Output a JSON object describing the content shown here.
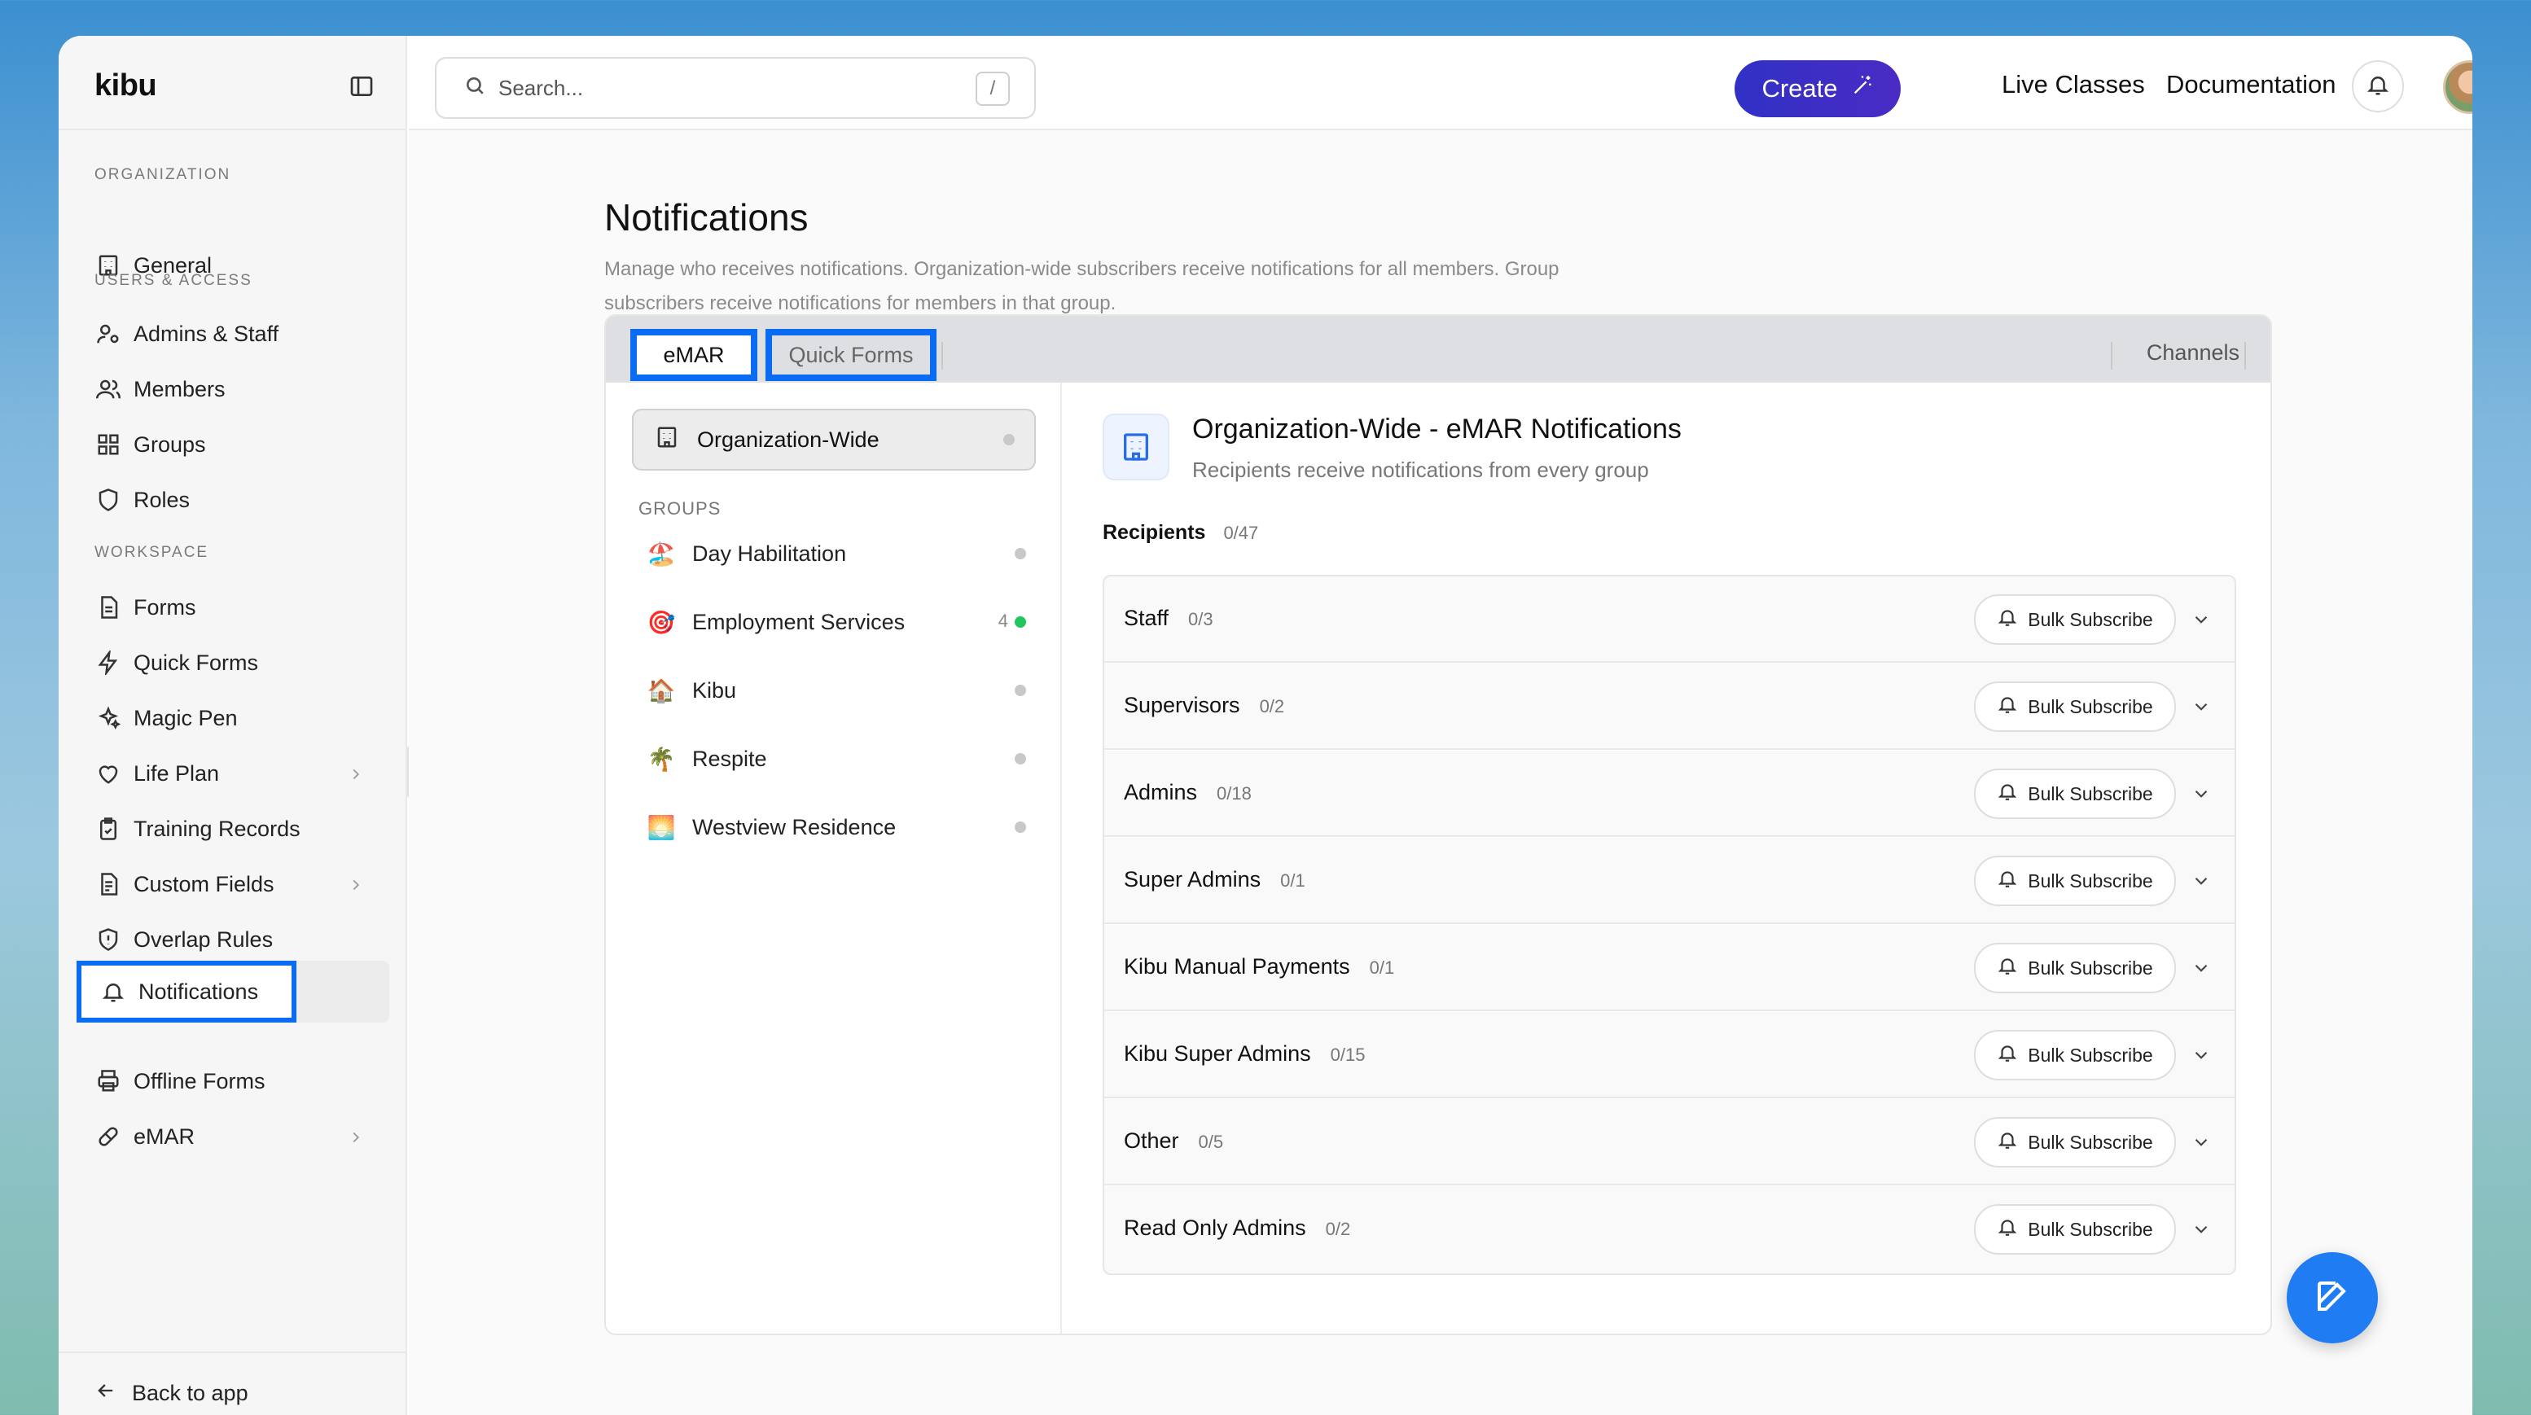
{
  "sidebar": {
    "brand": "kibu",
    "sections": {
      "organization": "ORGANIZATION",
      "users_access": "USERS & ACCESS",
      "workspace": "WORKSPACE"
    },
    "items": {
      "general": "General",
      "admins_staff": "Admins & Staff",
      "members": "Members",
      "groups": "Groups",
      "roles": "Roles",
      "forms": "Forms",
      "quick_forms": "Quick Forms",
      "magic_pen": "Magic Pen",
      "life_plan": "Life Plan",
      "training_records": "Training Records",
      "custom_fields": "Custom Fields",
      "overlap_rules": "Overlap Rules",
      "notifications": "Notifications",
      "offline_forms": "Offline Forms",
      "emar": "eMAR"
    },
    "back": "Back to app"
  },
  "topbar": {
    "search_placeholder": "Search...",
    "search_shortcut": "/",
    "create": "Create",
    "live_classes": "Live Classes",
    "documentation": "Documentation"
  },
  "page": {
    "title": "Notifications",
    "description": "Manage who receives notifications. Organization-wide subscribers receive notifications for all members. Group subscribers receive notifications for members in that group."
  },
  "tabs": {
    "emar": "eMAR",
    "quick_forms": "Quick Forms",
    "channels": "Channels"
  },
  "left_pane": {
    "org_wide": "Organization-Wide",
    "groups_label": "GROUPS",
    "groups": [
      {
        "name": "Day Habilitation",
        "emoji": "🏖️",
        "count": "",
        "status_color": "#c8c8c8"
      },
      {
        "name": "Employment Services",
        "emoji": "🎯",
        "count": "4",
        "status_color": "#22c55e"
      },
      {
        "name": "Kibu",
        "emoji": "🏠",
        "count": "",
        "status_color": "#c8c8c8"
      },
      {
        "name": "Respite",
        "emoji": "🌴",
        "count": "",
        "status_color": "#c8c8c8"
      },
      {
        "name": "Westview Residence",
        "emoji": "🌅",
        "count": "",
        "status_color": "#c8c8c8"
      }
    ]
  },
  "detail": {
    "title": "Organization-Wide - eMAR Notifications",
    "subtitle": "Recipients receive notifications from every group",
    "recipients_label": "Recipients",
    "recipients_count": "0/47",
    "bulk_label": "Bulk Subscribe",
    "rows": [
      {
        "name": "Staff",
        "count": "0/3"
      },
      {
        "name": "Supervisors",
        "count": "0/2"
      },
      {
        "name": "Admins",
        "count": "0/18"
      },
      {
        "name": "Super Admins",
        "count": "0/1"
      },
      {
        "name": "Kibu Manual Payments",
        "count": "0/1"
      },
      {
        "name": "Kibu Super Admins",
        "count": "0/15"
      },
      {
        "name": "Other",
        "count": "0/5"
      },
      {
        "name": "Read Only Admins",
        "count": "0/2"
      }
    ]
  },
  "colors": {
    "accent": "#0a6cf2",
    "create_button": "#3131c5",
    "fab": "#1f7cf2",
    "status_active": "#22c55e"
  },
  "icons": [
    "building-icon",
    "user-cog-icon",
    "users-icon",
    "grid-icon",
    "shield-icon",
    "file-icon",
    "bolt-icon",
    "sparkles-icon",
    "heart-icon",
    "clipboard-icon",
    "bell-icon",
    "printer-icon",
    "pill-icon",
    "search-icon",
    "edit-icon"
  ]
}
